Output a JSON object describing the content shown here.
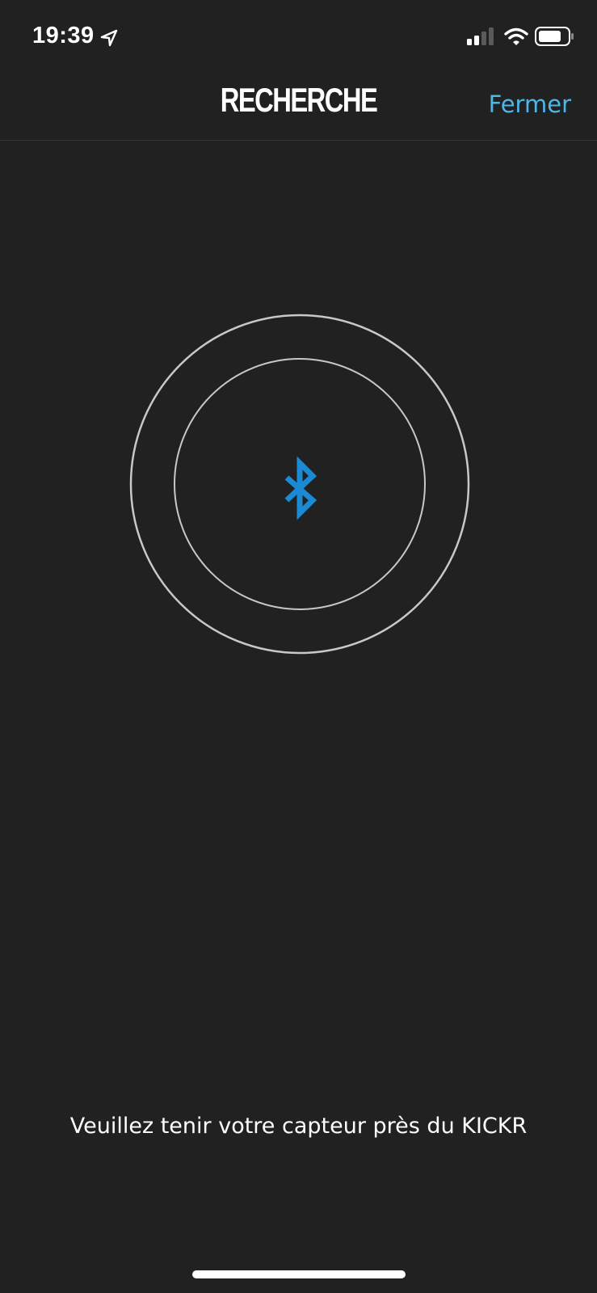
{
  "status_bar": {
    "time": "19:39",
    "location_icon": "location-arrow-icon",
    "signal_icon": "cellular-signal-icon",
    "wifi_icon": "wifi-icon",
    "battery_icon": "battery-icon"
  },
  "nav": {
    "title": "RECHERCHE",
    "close_label": "Fermer"
  },
  "search": {
    "icon": "bluetooth-icon"
  },
  "instruction": "Veuillez tenir votre capteur près du KICKR",
  "colors": {
    "background": "#212121",
    "accent": "#4fb6e8",
    "bluetooth": "#1a8ad4",
    "ring": "#c8c8c8"
  }
}
